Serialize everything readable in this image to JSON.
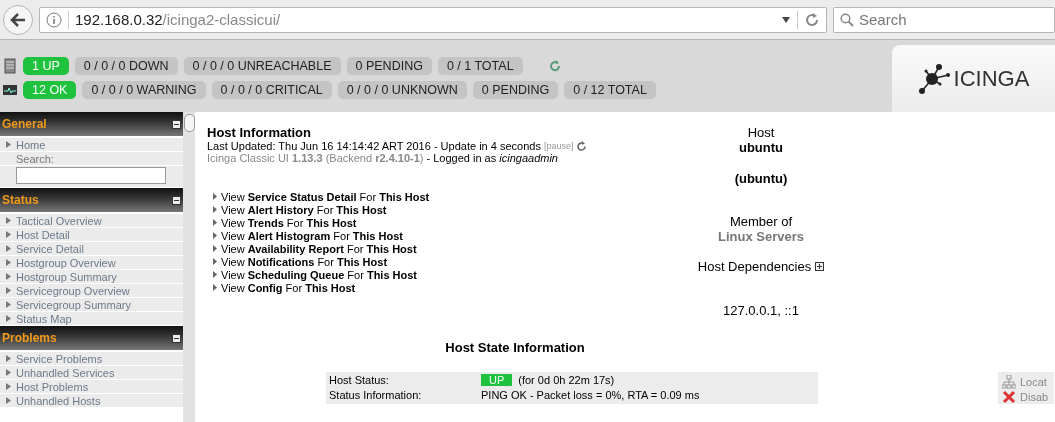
{
  "browser": {
    "url_host": "192.168.0.32",
    "url_path": "/icinga2-classicui/",
    "search_placeholder": "Search"
  },
  "host_totals": [
    {
      "label": "1 UP",
      "kind": "ok"
    },
    {
      "label": "0 / 0 / 0 DOWN",
      "kind": "count"
    },
    {
      "label": "0 / 0 / 0 UNREACHABLE",
      "kind": "count"
    },
    {
      "label": "0 PENDING",
      "kind": "count"
    },
    {
      "label": "0 / 1 TOTAL",
      "kind": "count"
    }
  ],
  "service_totals": [
    {
      "label": "12 OK",
      "kind": "ok"
    },
    {
      "label": "0 / 0 / 0 WARNING",
      "kind": "count"
    },
    {
      "label": "0 / 0 / 0 CRITICAL",
      "kind": "count"
    },
    {
      "label": "0 / 0 / 0 UNKNOWN",
      "kind": "count"
    },
    {
      "label": "0 PENDING",
      "kind": "count"
    },
    {
      "label": "0 / 12 TOTAL",
      "kind": "count"
    }
  ],
  "logo": {
    "text": "ICINGA"
  },
  "sidebar": [
    {
      "title": "General",
      "expanded": true,
      "items": [
        {
          "kind": "link",
          "label": "Home"
        },
        {
          "kind": "field",
          "label": "Search:"
        }
      ]
    },
    {
      "title": "Status",
      "expanded": true,
      "items": [
        {
          "kind": "link",
          "label": "Tactical Overview"
        },
        {
          "kind": "link",
          "label": "Host Detail"
        },
        {
          "kind": "link",
          "label": "Service Detail"
        },
        {
          "kind": "link",
          "label": "Hostgroup Overview"
        },
        {
          "kind": "link",
          "label": "Hostgroup Summary"
        },
        {
          "kind": "link",
          "label": "Servicegroup Overview"
        },
        {
          "kind": "link",
          "label": "Servicegroup Summary"
        },
        {
          "kind": "link",
          "label": "Status Map"
        }
      ]
    },
    {
      "title": "Problems",
      "expanded": true,
      "items": [
        {
          "kind": "link",
          "label": "Service Problems"
        },
        {
          "kind": "link",
          "label": "Unhandled Services"
        },
        {
          "kind": "link",
          "label": "Host Problems"
        },
        {
          "kind": "link",
          "label": "Unhandled Hosts"
        }
      ]
    }
  ],
  "info": {
    "title": "Host Information",
    "last_updated": "Last Updated: Thu Jun 16 14:14:42 ART 2016 - Update in 4 seconds",
    "pause": "[pause]",
    "version": "Icinga Classic UI **1.13.3** (Backend **r2.4.10-1**)",
    "login": "- Logged in as *icingaadmin*"
  },
  "links": [
    "View **Service Status Detail** For **This Host**",
    "View **Alert History** For **This Host**",
    "View **Trends** For **This Host**",
    "View **Alert Histogram** For **This Host**",
    "View **Availability Report** For **This Host**",
    "View **Notifications** For **This Host**",
    "View **Scheduling Queue** For **This Host**",
    "View **Config** For **This Host**"
  ],
  "host": {
    "heading": "Host",
    "name": "ubuntu",
    "alias": "(ubuntu)",
    "member_label": "Member of",
    "group": "Linux Servers",
    "dependencies": "Host Dependencies",
    "address": "127.0.0.1, ::1"
  },
  "state": {
    "heading": "Host State Information",
    "rows": [
      {
        "label": "Host Status:",
        "badge": "UP",
        "value": "(for 0d 0h 22m 17s)"
      },
      {
        "label": "Status Information:",
        "value": "PING OK - Packet loss = 0%, RTA = 0.09 ms"
      }
    ]
  },
  "commands": [
    {
      "kind": "locate",
      "label": "Locat"
    },
    {
      "kind": "disable",
      "label": "Disab"
    }
  ]
}
